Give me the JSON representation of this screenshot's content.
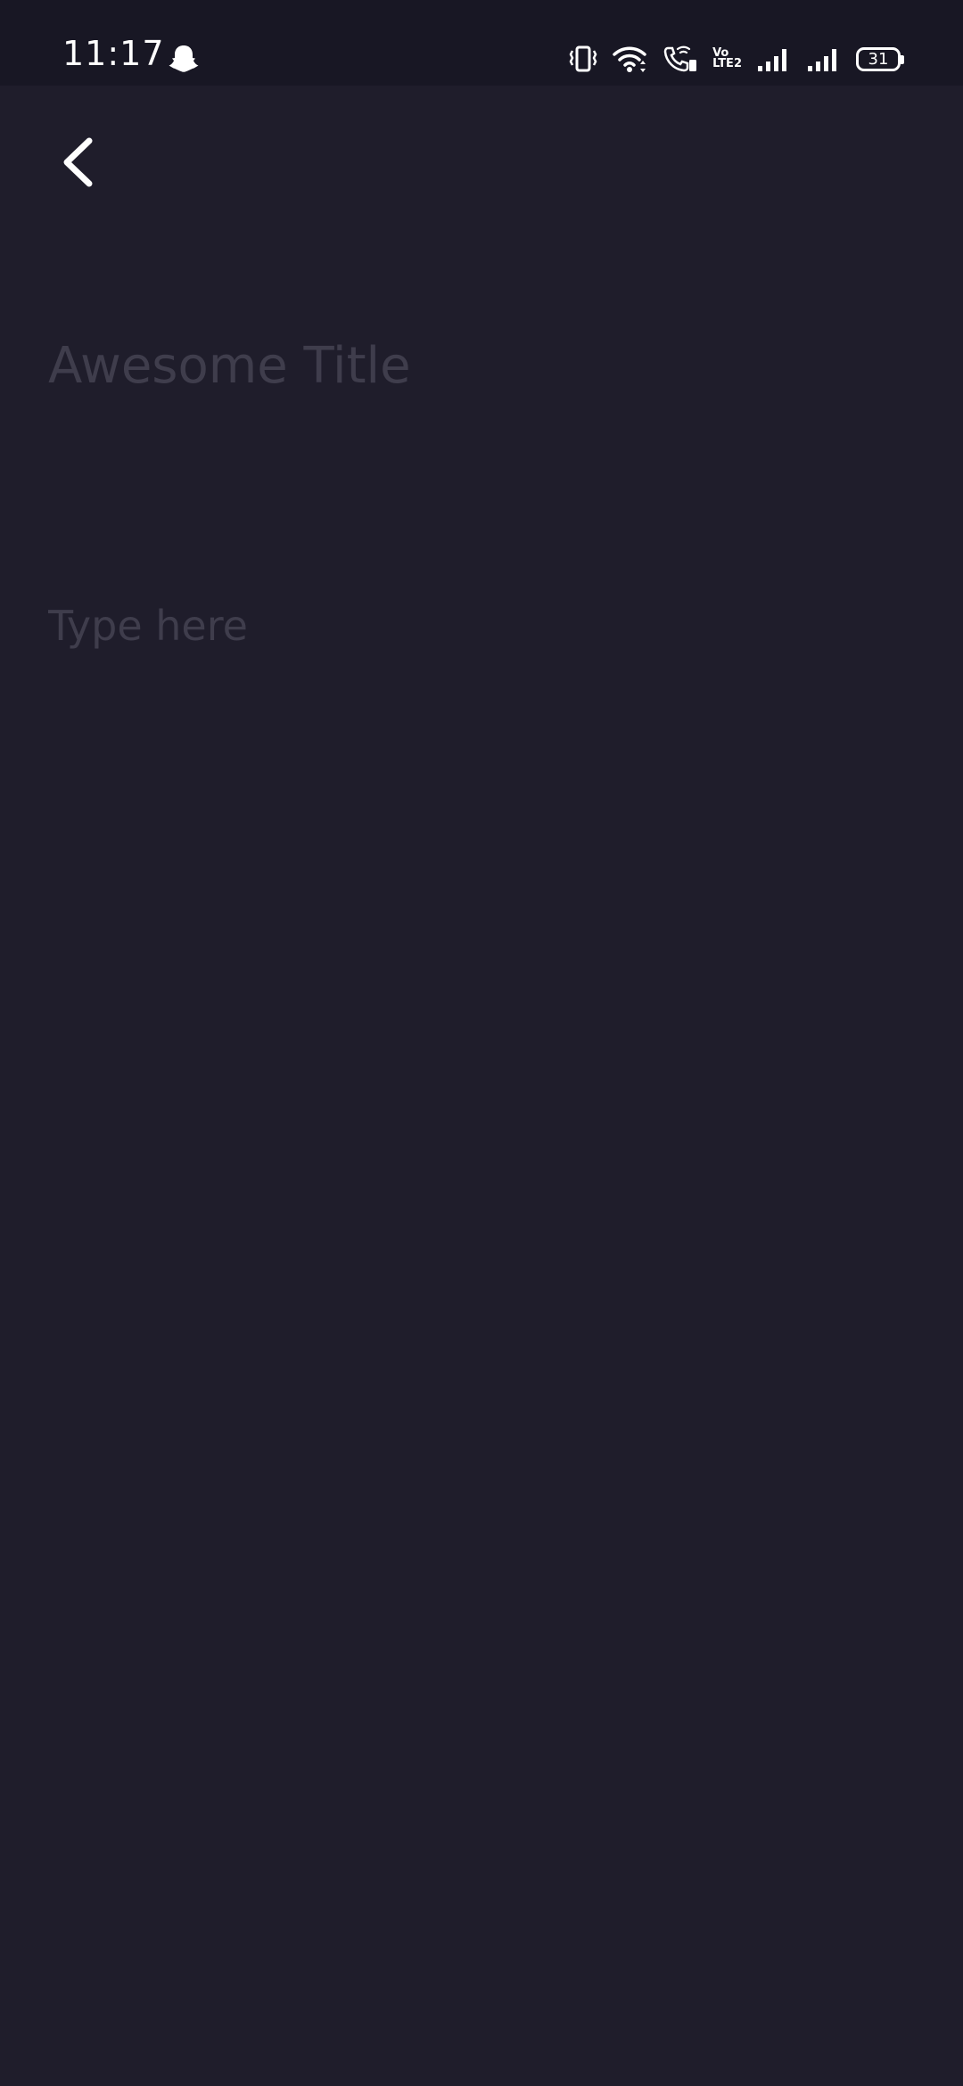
{
  "status_bar": {
    "time": "11:17",
    "lte_line1": "Vo",
    "lte_line2": "LTE2",
    "battery": "31"
  },
  "icons": {
    "notification": "snapchat-ghost-icon",
    "back": "chevron-left-icon"
  },
  "editor": {
    "title_placeholder": "Awesome Title",
    "body_placeholder": "Type here"
  },
  "colors": {
    "background": "#1f1d2b",
    "status_bar": "#181724",
    "placeholder": "#3f3d4c",
    "foreground": "#ffffff"
  }
}
